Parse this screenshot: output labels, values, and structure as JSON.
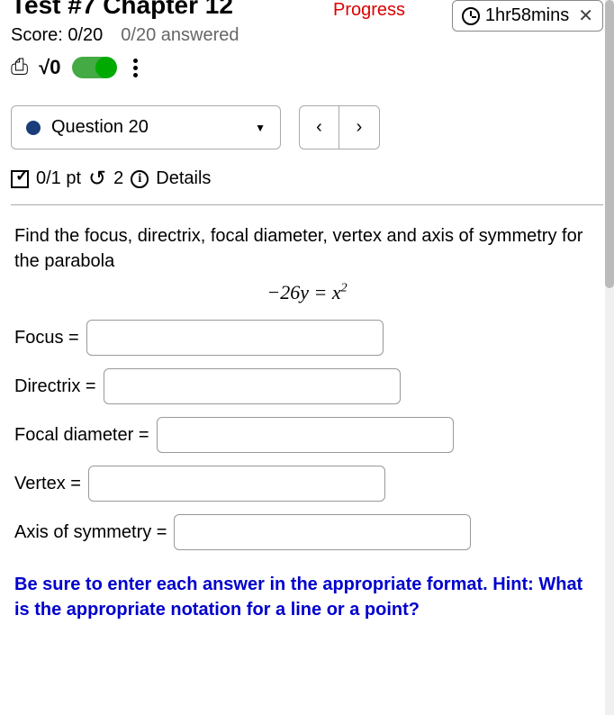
{
  "header": {
    "title": "Test #7 Chapter 12",
    "progress_label": "Progress",
    "timer": "1hr58mins"
  },
  "score": {
    "label": "Score: 0/20",
    "answered": "0/20 answered"
  },
  "nav": {
    "question_label": "Question 20",
    "prev": "‹",
    "next": "›"
  },
  "points": {
    "value": "0/1 pt",
    "retries": "2",
    "details": "Details"
  },
  "question": {
    "prompt": "Find the focus, directrix, focal diameter, vertex and axis of symmetry for the parabola",
    "equation_lhs": "−26y",
    "equation_eq": " = ",
    "equation_rhs_base": "x",
    "equation_rhs_exp": "2",
    "fields": {
      "focus": "Focus =",
      "directrix": "Directrix =",
      "focal_diameter": "Focal diameter =",
      "vertex": "Vertex =",
      "axis": "Axis of symmetry ="
    },
    "hint": "Be sure to enter each answer in the appropriate format. Hint: What is the appropriate notation for a line or a point?"
  }
}
